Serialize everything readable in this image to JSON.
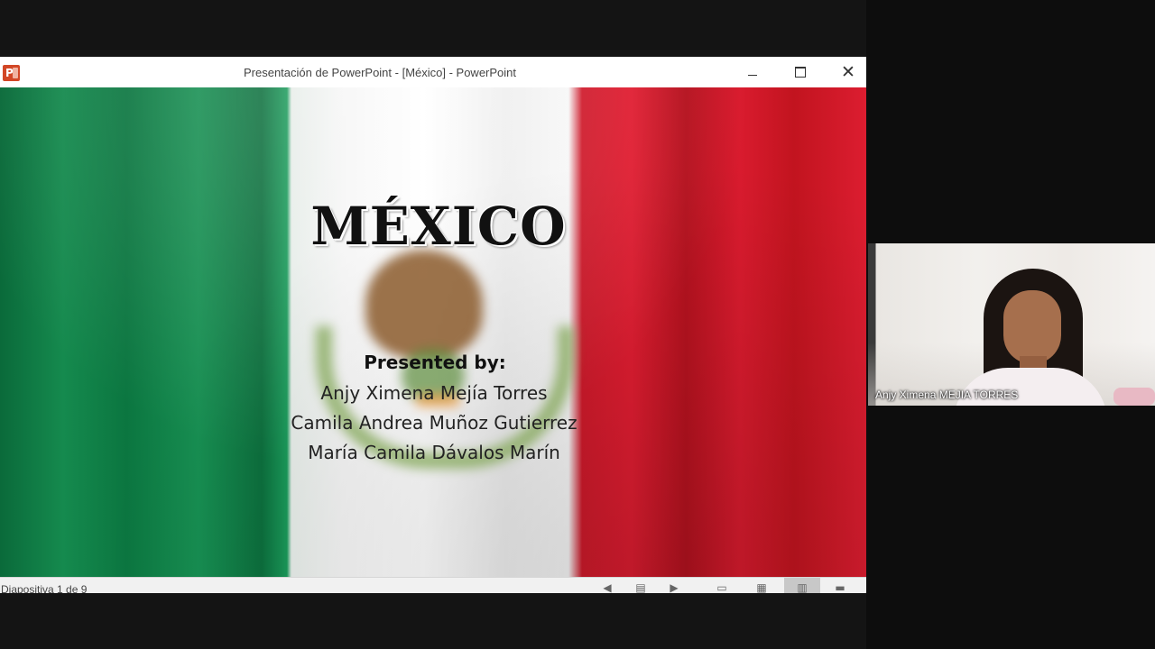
{
  "window": {
    "title": "Presentación de PowerPoint - [México] - PowerPoint",
    "app_icon_label": "P"
  },
  "slide": {
    "title": "MÉXICO",
    "presented_by": "Presented by:",
    "names": [
      "Anjy Ximena Mejía Torres",
      "Camila Andrea Muñoz Gutierrez",
      "María Camila Dávalos Marín"
    ],
    "flag_colors": {
      "green": "#0b7640",
      "white": "#ffffff",
      "red": "#d91b2e"
    }
  },
  "status_bar": {
    "slide_indicator": "Diapositiva 1 de 9",
    "icons": [
      "previous-slide-icon",
      "notes-icon",
      "next-slide-icon",
      "normal-view-icon",
      "slide-sorter-icon",
      "reading-view-icon",
      "slideshow-icon"
    ]
  },
  "participant": {
    "name": "Anjy Ximena MEJIA TORRES"
  }
}
